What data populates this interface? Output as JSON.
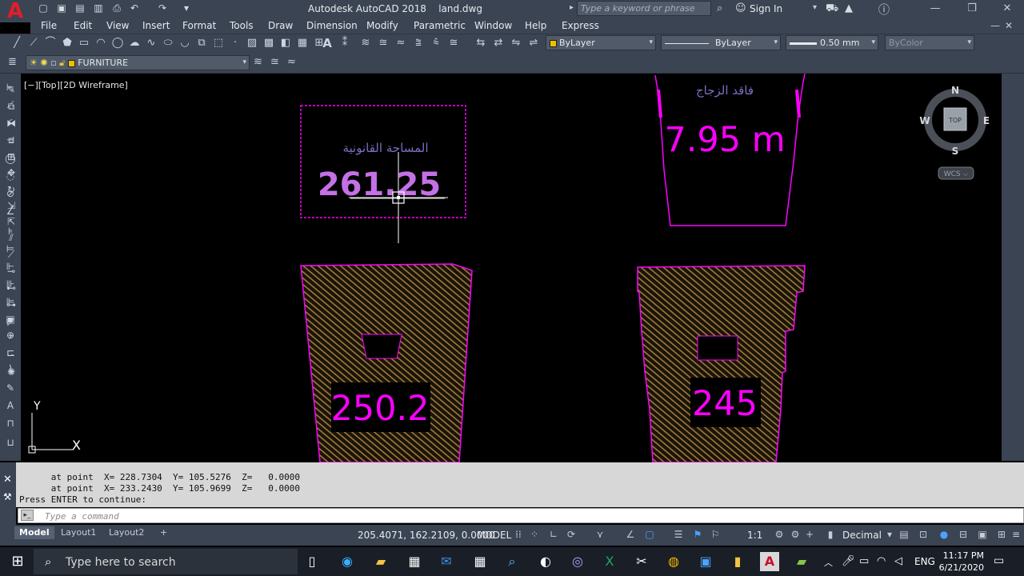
{
  "app": {
    "title": "Autodesk AutoCAD 2018",
    "file": "land.dwg",
    "logo_letter": "A",
    "search_placeholder": "Type a keyword or phrase",
    "sign_in": "Sign In"
  },
  "menu": [
    "File",
    "Edit",
    "View",
    "Insert",
    "Format",
    "Tools",
    "Draw",
    "Dimension",
    "Modify",
    "Parametric",
    "Window",
    "Help",
    "Express"
  ],
  "properties": {
    "color": "ByLayer",
    "linetype": "ByLayer",
    "lineweight": "0.50 mm",
    "plotstyle": "ByColor",
    "layer": "FURNITURE"
  },
  "viewport": {
    "label": "[−][Top][2D Wireframe]",
    "compass": {
      "n": "N",
      "s": "S",
      "e": "E",
      "w": "W",
      "top": "TOP"
    },
    "wcs": "WCS ⌵"
  },
  "drawing": {
    "box1_arabic": "المساحة القانونية",
    "box1_value": "261.25",
    "box2_arabic": "فاقد الزجاج",
    "box2_value": "7.95 m",
    "plot1_value": "250.2",
    "plot2_value": "245",
    "ucs_x": "X",
    "ucs_y": "Y"
  },
  "colors": {
    "magenta": "#ff00ff",
    "hatch": "#a07a3c",
    "arabic_text": "#7b6fc3"
  },
  "command": {
    "line1": "      at point  X= 228.7304  Y= 105.5276  Z=   0.0000",
    "line2": "      at point  X= 233.2430  Y= 105.9699  Z=   0.0000",
    "line3": "Press ENTER to continue:",
    "placeholder": "Type a command"
  },
  "status": {
    "tabs": [
      "Model",
      "Layout1",
      "Layout2"
    ],
    "coords": "205.4071, 162.2109, 0.0000",
    "model": "MODEL",
    "scale": "1:1",
    "units": "Decimal"
  },
  "taskbar": {
    "search": "Type here to search",
    "lang": "ENG",
    "time": "11:17 PM",
    "date": "6/21/2020"
  }
}
